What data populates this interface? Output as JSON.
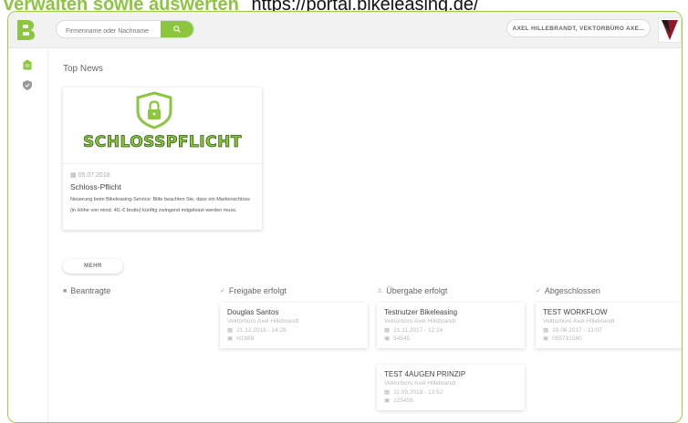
{
  "caption": {
    "highlight": "verwalten sowie auswerten",
    "url": "https://portal.bikeleasing.de/"
  },
  "header": {
    "search_placeholder": "Firmenname oder Nachname",
    "user_label": "AXEL HILLEBRANDT, VEKTORBÜRO AXE..."
  },
  "colors": {
    "brand_green": "#8cc63f",
    "brand_red": "#8b1a2b"
  },
  "main": {
    "section_title": "Top News",
    "news": {
      "image_text": "SCHLOSSPFLICHT",
      "date": "05.07.2018",
      "title": "Schloss-Pflicht",
      "text": "Neuerung beim Bikeleasing-Service: Bitte beachten Sie, dass ein Markenschloss (in Höhe von mind. 40,-€ brutto) künftig zwingend mitgeleast werden muss."
    },
    "more_button": "MEHR"
  },
  "columns": {
    "beantragte": {
      "label": "Beantragte"
    },
    "freigabe": {
      "label": "Freigabe erfolgt",
      "tasks": [
        {
          "title": "Douglas Santos",
          "company": "Vektorbüro Axel Hillebrandt",
          "datetime": "21.12.2018 - 14:28",
          "id": "H1889"
        }
      ]
    },
    "uebergabe": {
      "label": "Übergabe erfolgt",
      "tasks": [
        {
          "title": "Testnutzer Bikeleasing",
          "company": "Vektorbüro Axel Hillebrandt",
          "datetime": "21.11.2017 - 12:24",
          "id": "54545"
        },
        {
          "title": "TEST 4AUGEN PRINZIP",
          "company": "Vektorbüro Axel Hillebrandt",
          "datetime": "11.09.2018 - 13:52",
          "id": "125456"
        }
      ]
    },
    "abgeschlossen": {
      "label": "Abgeschlossen",
      "tasks": [
        {
          "title": "TEST WORKFLOW",
          "company": "Vektorbüro Axel Hillebrandt",
          "datetime": "19.06.2017 - 13:07",
          "id": "055731580"
        }
      ]
    }
  }
}
